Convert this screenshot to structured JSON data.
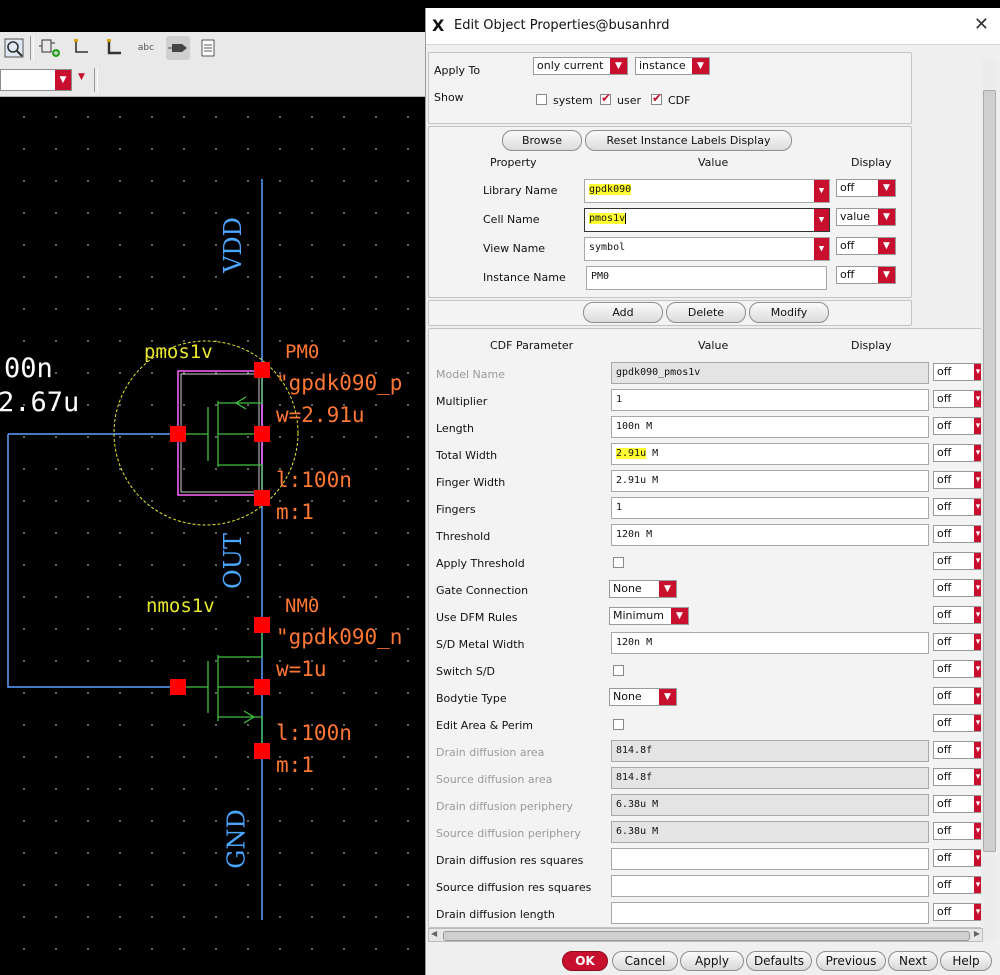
{
  "toolbar": {
    "icons": [
      "zoom-fit-icon",
      "add-instance-icon",
      "add-wire-icon",
      "add-wire-narrow-icon",
      "add-label-icon",
      "add-pin-icon",
      "property-icon"
    ],
    "label_icon_text": "abc"
  },
  "schematic": {
    "left_values": [
      "00n",
      "2.67u"
    ],
    "pmos": {
      "cell": "pmos1v",
      "name": "PM0",
      "lib": "\"gpdk090_p",
      "w": "w=2.91u",
      "l": "l:100n",
      "m": "m:1"
    },
    "nmos": {
      "cell": "nmos1v",
      "name": "NM0",
      "lib": "\"gpdk090_n",
      "w": "w=1u",
      "l": "l:100n",
      "m": "m:1"
    },
    "nets": {
      "vdd": "VDD",
      "out": "OUT",
      "gnd": "GND"
    },
    "colors": {
      "wire": "#5aa0ff",
      "device": "#40c040",
      "label": "#ff7733",
      "cellname": "#e8e830",
      "pin": "#ff0000",
      "netlabel": "#4aa6ff"
    }
  },
  "dialog": {
    "title": "Edit Object Properties@busanhrd",
    "apply_to_label": "Apply To",
    "apply_to_value": "only current",
    "apply_to_scope": "instance",
    "show_label": "Show",
    "show_options": [
      {
        "label": "system",
        "checked": false
      },
      {
        "label": "user",
        "checked": true
      },
      {
        "label": "CDF",
        "checked": true
      }
    ],
    "browse_label": "Browse",
    "reset_label": "Reset Instance Labels Display",
    "prop_header": {
      "property": "Property",
      "value": "Value",
      "display": "Display"
    },
    "properties": [
      {
        "label": "Library Name",
        "value": "gpdk090",
        "display": "off"
      },
      {
        "label": "Cell Name",
        "value": "pmos1v",
        "display": "value"
      },
      {
        "label": "View Name",
        "value": "symbol",
        "display": "off"
      },
      {
        "label": "Instance Name",
        "value": "PM0",
        "display": "off"
      }
    ],
    "add_label": "Add",
    "delete_label": "Delete",
    "modify_label": "Modify",
    "cdf_header": {
      "param": "CDF Parameter",
      "value": "Value",
      "display": "Display"
    },
    "cdf_params": [
      {
        "label": "Model Name",
        "type": "field",
        "value": "gpdk090_pmos1v",
        "readonly": true,
        "disabled": true
      },
      {
        "label": "Multiplier",
        "type": "field",
        "value": "1"
      },
      {
        "label": "Length",
        "type": "field",
        "value": "100n M"
      },
      {
        "label": "Total Width",
        "type": "field",
        "value": "2.91u",
        "suffix": " M",
        "highlight": true
      },
      {
        "label": "Finger Width",
        "type": "field",
        "value": "2.91u M"
      },
      {
        "label": "Fingers",
        "type": "field",
        "value": "1"
      },
      {
        "label": "Threshold",
        "type": "field",
        "value": "120n M"
      },
      {
        "label": "Apply Threshold",
        "type": "check"
      },
      {
        "label": "Gate Connection",
        "type": "select",
        "value": "None"
      },
      {
        "label": "Use DFM Rules",
        "type": "select",
        "value": "Minimum"
      },
      {
        "label": "S/D Metal Width",
        "type": "field",
        "value": "120n M"
      },
      {
        "label": "Switch S/D",
        "type": "check"
      },
      {
        "label": "Bodytie Type",
        "type": "select",
        "value": "None"
      },
      {
        "label": "Edit Area & Perim",
        "type": "check"
      },
      {
        "label": "Drain diffusion area",
        "type": "field",
        "value": "814.8f",
        "readonly": true,
        "disabled": true
      },
      {
        "label": "Source diffusion area",
        "type": "field",
        "value": "814.8f",
        "readonly": true,
        "disabled": true
      },
      {
        "label": "Drain diffusion periphery",
        "type": "field",
        "value": "6.38u M",
        "readonly": true,
        "disabled": true
      },
      {
        "label": "Source diffusion periphery",
        "type": "field",
        "value": "6.38u M",
        "readonly": true,
        "disabled": true
      },
      {
        "label": "Drain diffusion res squares",
        "type": "field",
        "value": ""
      },
      {
        "label": "Source diffusion res squares",
        "type": "field",
        "value": ""
      },
      {
        "label": "Drain diffusion length",
        "type": "field",
        "value": ""
      }
    ],
    "cdf_display": "off",
    "buttons": [
      "OK",
      "Cancel",
      "Apply",
      "Defaults",
      "Previous",
      "Next",
      "Help"
    ]
  }
}
